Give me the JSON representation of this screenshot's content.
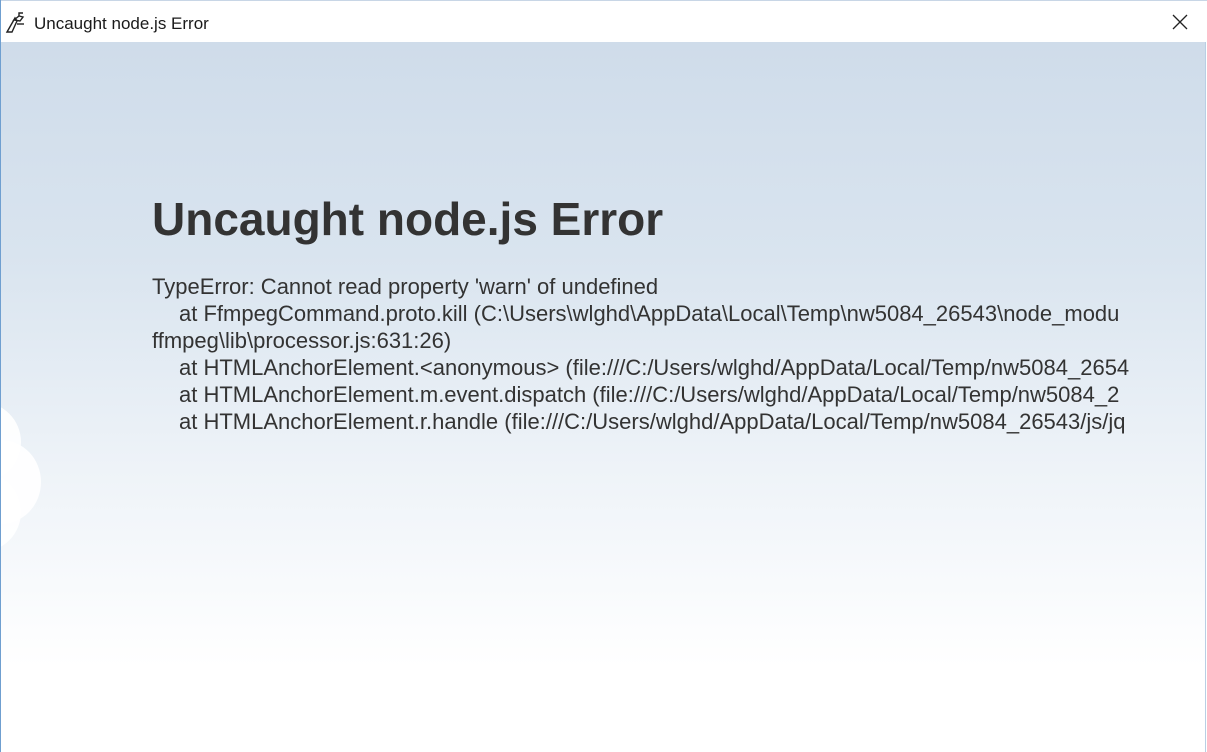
{
  "window": {
    "title": "Uncaught node.js Error",
    "icon": "nwjs-app-icon",
    "close_icon": "close-icon"
  },
  "error": {
    "heading": "Uncaught node.js Error",
    "lines": [
      "TypeError: Cannot read property 'warn' of undefined",
      "at FfmpegCommand.proto.kill (C:\\Users\\wlghd\\AppData\\Local\\Temp\\nw5084_26543\\node_modu",
      "ffmpeg\\lib\\processor.js:631:26)",
      "at HTMLAnchorElement.<anonymous> (file:///C:/Users/wlghd/AppData/Local/Temp/nw5084_2654",
      "at HTMLAnchorElement.m.event.dispatch (file:///C:/Users/wlghd/AppData/Local/Temp/nw5084_2",
      "at HTMLAnchorElement.r.handle (file:///C:/Users/wlghd/AppData/Local/Temp/nw5084_26543/js/jq"
    ]
  },
  "colors": {
    "heading": "#333333",
    "text": "#333333",
    "border": "#6f9fd0",
    "gradient_top": "#cfdcea",
    "gradient_bottom": "#ffffff"
  }
}
